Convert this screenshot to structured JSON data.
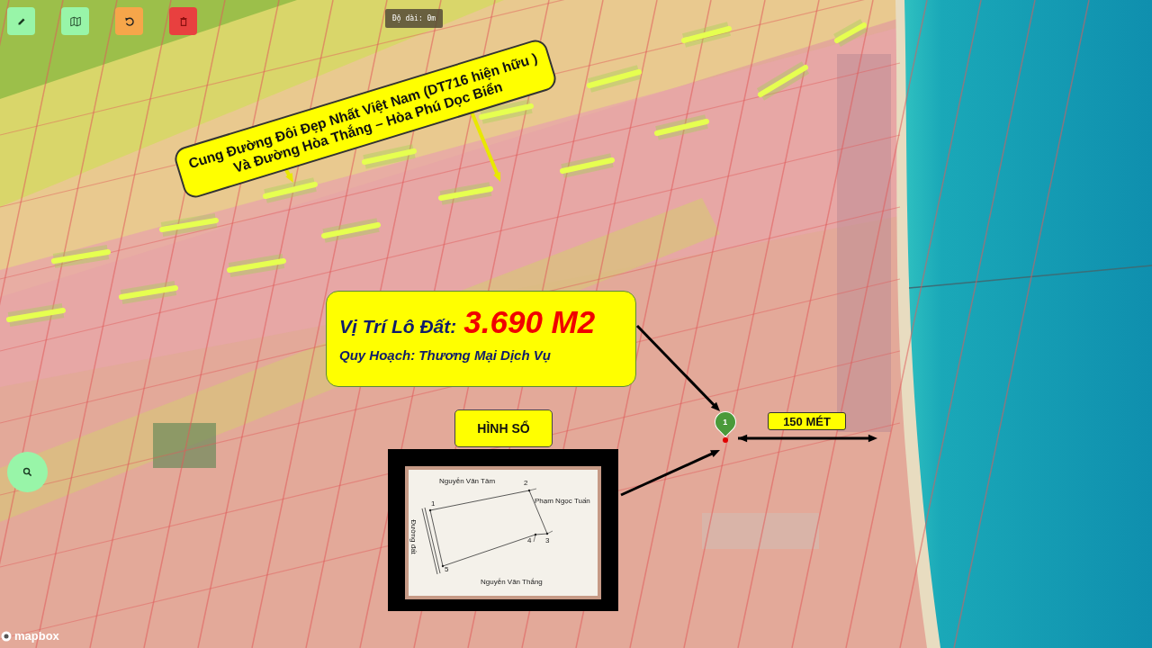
{
  "toolbar": {
    "buttons": [
      {
        "kind": "draw",
        "color": "#98f5a8"
      },
      {
        "kind": "map",
        "color": "#98f5a8"
      },
      {
        "kind": "undo",
        "color": "#f6a64a"
      },
      {
        "kind": "delete",
        "color": "#e8403f"
      }
    ]
  },
  "measure": {
    "label": "Độ dài: 0m"
  },
  "road_callout": {
    "lines": [
      "Cung Đường Đôi Đẹp Nhất Việt Nam (DT716 hiện hữu )",
      "Và Đường Hòa Thắng – Hòa Phú Dọc Biển"
    ]
  },
  "lot_callout": {
    "title": "Vị Trí Lô Đất:",
    "area": "3.690 M2",
    "planning": "Quy Hoạch: Thương Mại Dịch Vụ"
  },
  "plan": {
    "label": "HÌNH SỔ",
    "streets": [
      "Nguyễn Văn Tâm",
      "Phạm Ngọc Tuấn",
      "Đường đất",
      "Nguyễn Văn Thắng"
    ],
    "points": [
      "1",
      "2",
      "3",
      "4",
      "5"
    ]
  },
  "marker": {
    "label": "1"
  },
  "distance": {
    "label": "150 MÉT"
  },
  "attribution": {
    "label": "mapbox"
  }
}
